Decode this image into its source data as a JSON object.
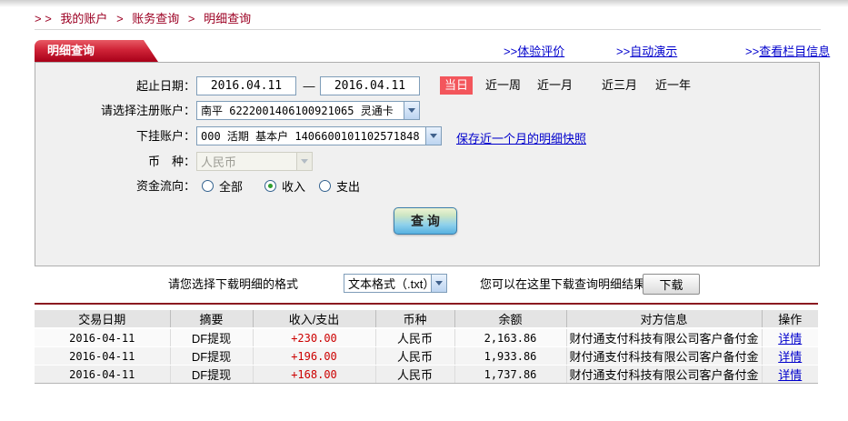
{
  "breadcrumb": {
    "prefix": "> >",
    "separator": ">",
    "items": [
      "我的账户",
      "账务查询",
      "明细查询"
    ]
  },
  "tab": {
    "title": "明细查询"
  },
  "header_links": {
    "prefix": ">>",
    "links": [
      "体验评价",
      "自动演示",
      "查看栏目信息"
    ]
  },
  "form": {
    "date_label": "起止日期：",
    "date_from": "2016.04.11",
    "date_dash": "—",
    "date_to": "2016.04.11",
    "today_badge": "当日",
    "quick_ranges": [
      "近一周",
      "近一月",
      "近三月",
      "近一年"
    ],
    "register_account_label": "请选择注册账户：",
    "register_account_value": "南平 6222001406100921065 灵通卡",
    "sub_account_label": "下挂账户：",
    "sub_account_value": "000 活期 基本户 1406600101102571848",
    "snapshot_link": "保存近一个月的明细快照",
    "currency_label": "币　种：",
    "currency_value": "人民币",
    "flow_label": "资金流向：",
    "flow_options": [
      {
        "label": "全部",
        "checked": false
      },
      {
        "label": "收入",
        "checked": true
      },
      {
        "label": "支出",
        "checked": false
      }
    ],
    "query_button": "查 询"
  },
  "download": {
    "format_label": "请您选择下载明细的格式",
    "format_value": "文本格式（.txt）",
    "hint": "您可以在这里下载查询明细结果",
    "button": "下载"
  },
  "table": {
    "headers": [
      "交易日期",
      "摘要",
      "收入/支出",
      "币种",
      "余额",
      "对方信息",
      "操作"
    ],
    "rows": [
      {
        "date": "2016-04-11",
        "summary": "DF提现",
        "amount": "+230.00",
        "currency": "人民币",
        "balance": "2,163.86",
        "counterparty": "财付通支付科技有限公司客户备付金",
        "action": "详情"
      },
      {
        "date": "2016-04-11",
        "summary": "DF提现",
        "amount": "+196.00",
        "currency": "人民币",
        "balance": "1,933.86",
        "counterparty": "财付通支付科技有限公司客户备付金",
        "action": "详情"
      },
      {
        "date": "2016-04-11",
        "summary": "DF提现",
        "amount": "+168.00",
        "currency": "人民币",
        "balance": "1,737.86",
        "counterparty": "财付通支付科技有限公司客户备付金",
        "action": "详情"
      }
    ]
  },
  "colors": {
    "accent_red": "#b0001e",
    "tab_red_top": "#e85a64",
    "tab_red_bottom": "#a80019",
    "badge_red": "#f3565c",
    "amount_red": "#cc0000",
    "link_blue": "#0000cc",
    "button_blue": "#57b1e0",
    "panel_gray": "#f0f0f0"
  }
}
